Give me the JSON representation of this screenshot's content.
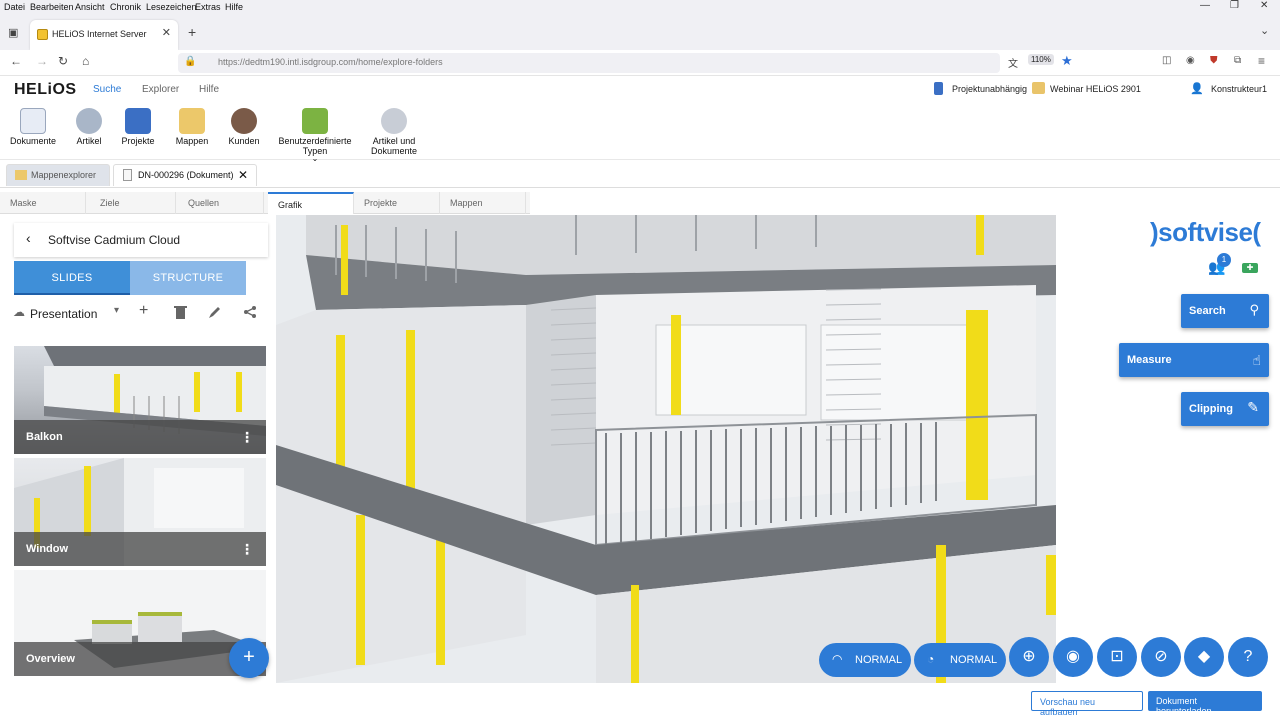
{
  "menu": [
    "Datei",
    "Bearbeiten",
    "Ansicht",
    "Chronik",
    "Lesezeichen",
    "Extras",
    "Hilfe"
  ],
  "browser": {
    "tab_title": "HELiOS Internet Server",
    "url": "https://dedtm190.intl.isdgroup.com/home/explore-folders",
    "zoom": "110%"
  },
  "app": {
    "logo": "HELiOS",
    "nav": [
      "Suche",
      "Explorer",
      "Hilfe"
    ],
    "project_scope": "Projektunabhängig",
    "webinar": "Webinar HELiOS 2901",
    "user": "Konstrukteur1"
  },
  "ribbon": [
    {
      "label": "Dokumente"
    },
    {
      "label": "Artikel"
    },
    {
      "label": "Projekte"
    },
    {
      "label": "Mappen"
    },
    {
      "label": "Kunden"
    },
    {
      "label": "Benutzerdefinierte Typen"
    },
    {
      "label": "Artikel und Dokumente"
    }
  ],
  "doc_tabs": [
    "Mappenexplorer",
    "DN-000296 (Dokument)"
  ],
  "sub_tabs": [
    "Maske",
    "Ziele",
    "Quellen",
    "Grafik",
    "Projekte",
    "Mappen"
  ],
  "panel": {
    "title": "Softvise Cadmium Cloud",
    "seg_slides": "SLIDES",
    "seg_structure": "STRUCTURE",
    "presentation": "Presentation",
    "slides": [
      {
        "label": "Balkon"
      },
      {
        "label": "Window"
      },
      {
        "label": "Overview"
      }
    ]
  },
  "right": {
    "brand": ")softvise(",
    "user_badge": "1",
    "search": "Search",
    "measure": "Measure",
    "clipping": "Clipping"
  },
  "toolbar": {
    "mode1": "NORMAL",
    "mode2": "NORMAL"
  },
  "footer": {
    "rebuild": "Vorschau neu aufbauen",
    "download": "Dokument herunterladen"
  },
  "colors": {
    "accent": "#2d7bd6",
    "seg_active": "#3f8fd8",
    "seg_inactive": "#8ab8e8"
  }
}
